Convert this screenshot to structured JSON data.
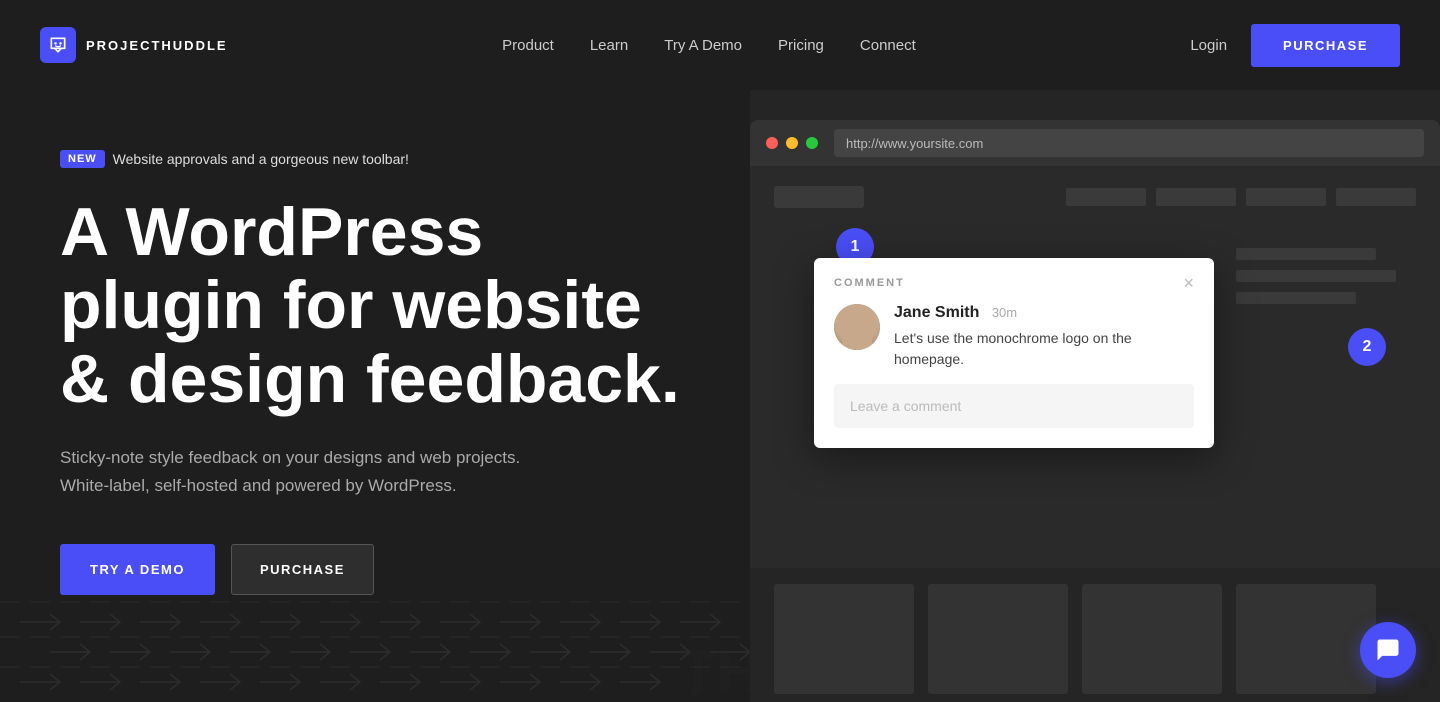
{
  "nav": {
    "logo_text": "PROJECTHUDDLE",
    "links": [
      {
        "label": "Product",
        "id": "product"
      },
      {
        "label": "Learn",
        "id": "learn"
      },
      {
        "label": "Try A Demo",
        "id": "try-demo"
      },
      {
        "label": "Pricing",
        "id": "pricing"
      },
      {
        "label": "Connect",
        "id": "connect"
      }
    ],
    "login_label": "Login",
    "purchase_label": "PURCHASE"
  },
  "hero": {
    "badge_new": "NEW",
    "badge_text": "Website approvals and a gorgeous new toolbar!",
    "title": "A WordPress plugin for website & design feedback.",
    "subtitle": "Sticky-note style feedback on your designs and web projects. White-label, self-hosted and powered by WordPress.",
    "btn_demo": "TRY A DEMO",
    "btn_purchase": "PURCHASE"
  },
  "browser": {
    "url": "http://www.yoursite.com"
  },
  "comment": {
    "label": "COMMENT",
    "author": "Jane Smith",
    "time": "30m",
    "text": "Let's use the monochrome logo on the homepage.",
    "input_placeholder": "Leave a comment",
    "pin1": "1",
    "pin2": "2"
  }
}
